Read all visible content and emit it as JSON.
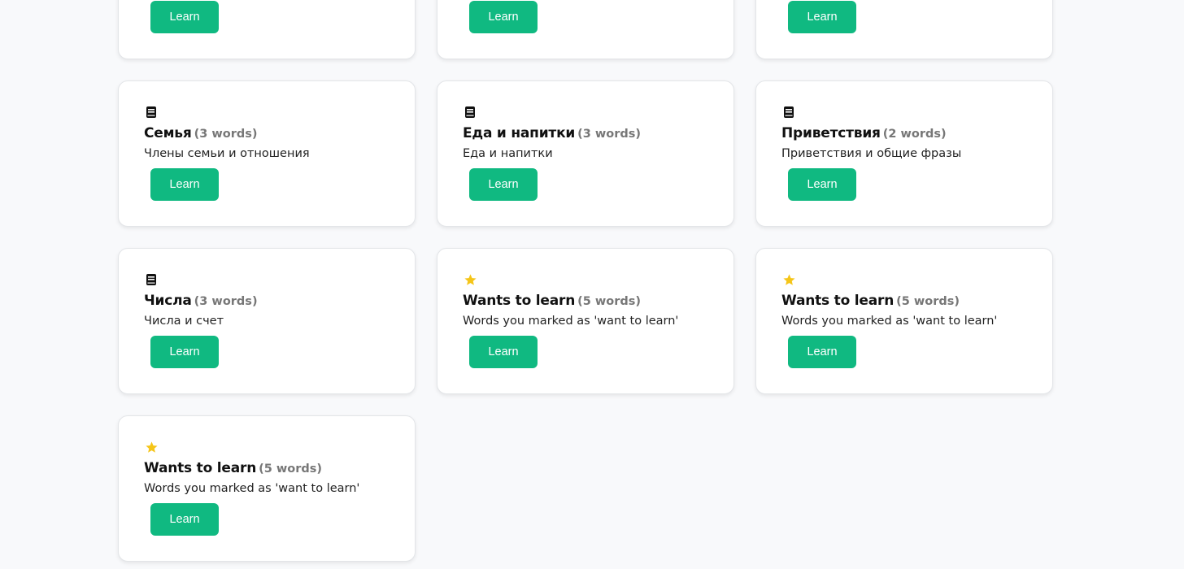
{
  "colors": {
    "accent": "#10b981",
    "star": "#f5c518",
    "book": "#111111",
    "card_bg": "#ffffff",
    "page_bg": "#f8f9fb"
  },
  "cards": [
    {
      "icon": "book-icon",
      "title": "",
      "count": "",
      "description": "",
      "button_label": "Learn"
    },
    {
      "icon": "book-icon",
      "title": "",
      "count": "",
      "description": "",
      "button_label": "Learn"
    },
    {
      "icon": "book-icon",
      "title": "",
      "count": "",
      "description": "",
      "button_label": "Learn"
    },
    {
      "icon": "book-icon",
      "title": "Семья",
      "count": "(3 words)",
      "description": "Члены семьи и отношения",
      "button_label": "Learn"
    },
    {
      "icon": "book-icon",
      "title": "Еда и напитки",
      "count": "(3 words)",
      "description": "Еда и напитки",
      "button_label": "Learn"
    },
    {
      "icon": "book-icon",
      "title": "Приветствия",
      "count": "(2 words)",
      "description": "Приветствия и общие фразы",
      "button_label": "Learn"
    },
    {
      "icon": "book-icon",
      "title": "Числа",
      "count": "(3 words)",
      "description": "Числа и счет",
      "button_label": "Learn"
    },
    {
      "icon": "star-icon",
      "title": "Wants to learn",
      "count": "(5 words)",
      "description": "Words you marked as 'want to learn'",
      "button_label": "Learn"
    },
    {
      "icon": "star-icon",
      "title": "Wants to learn",
      "count": "(5 words)",
      "description": "Words you marked as 'want to learn'",
      "button_label": "Learn"
    },
    {
      "icon": "star-icon",
      "title": "Wants to learn",
      "count": "(5 words)",
      "description": "Words you marked as 'want to learn'",
      "button_label": "Learn"
    }
  ]
}
